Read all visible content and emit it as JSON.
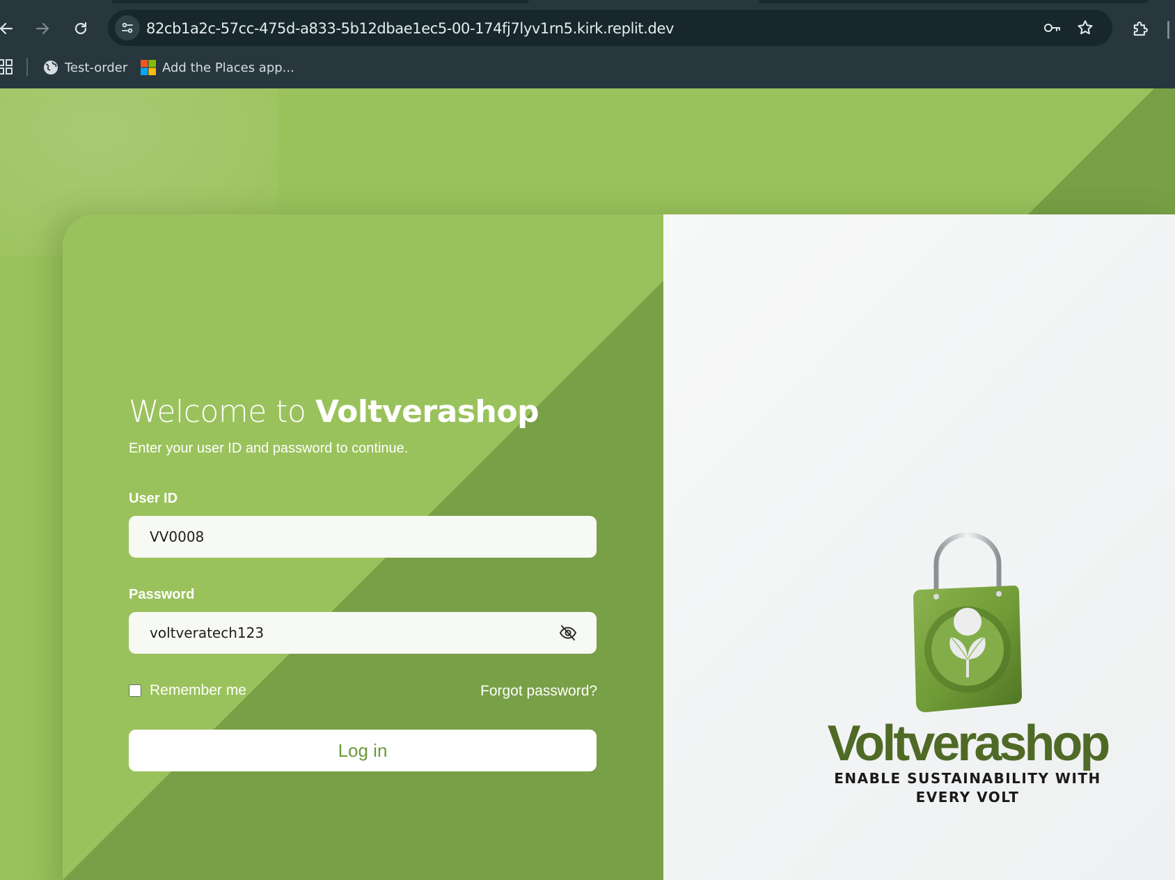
{
  "browser": {
    "url": "82cb1a2c-57cc-475d-a833-5b12dbae1ec5-00-174fj7lyv1rn5.kirk.replit.dev",
    "bookmarks": [
      {
        "label": "Test-order",
        "icon": "globe-icon"
      },
      {
        "label": "Add the Places app...",
        "icon": "microsoft-icon"
      }
    ]
  },
  "login": {
    "welcome_prefix": "Welcome to",
    "brand": "Voltverashop",
    "subtitle": "Enter your user ID and password to continue.",
    "user_id_label": "User ID",
    "user_id_value": "VV0008",
    "password_label": "Password",
    "password_value": "voltveratech123",
    "remember_label": "Remember me",
    "remember_checked": false,
    "forgot_label": "Forgot password?",
    "login_label": "Log in"
  },
  "logo": {
    "wordmark": "Voltverashop",
    "tagline_line1": "ENABLE SUSTAINABILITY WITH",
    "tagline_line2": "EVERY VOLT"
  },
  "colors": {
    "accent_green": "#9ac25c",
    "dark_green": "#78a046",
    "brand_text": "#4f6a26",
    "button_text": "#6a9a3c"
  }
}
